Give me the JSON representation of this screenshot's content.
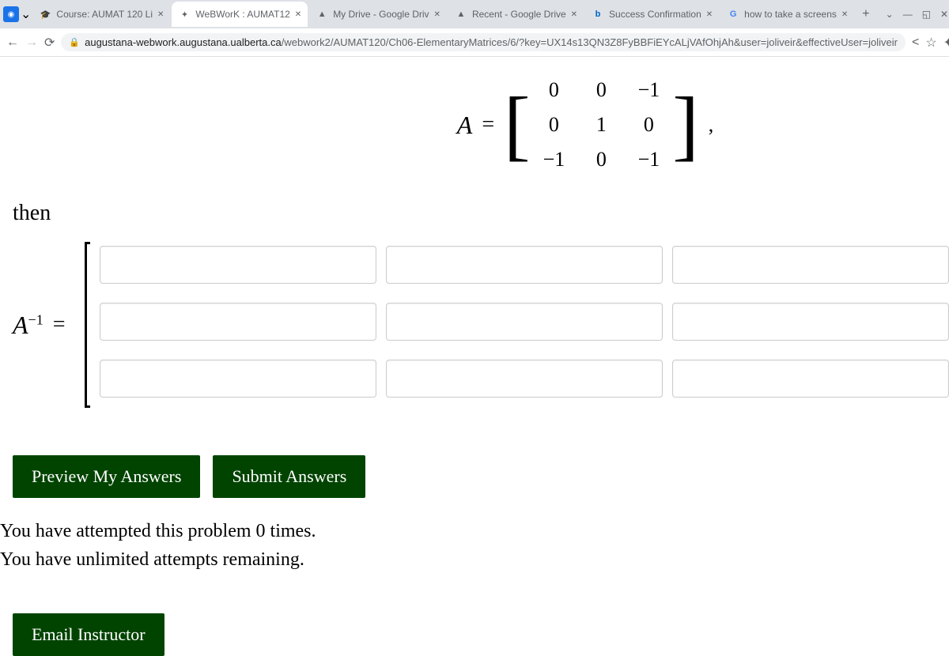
{
  "tabs": [
    {
      "title": "Course: AUMAT 120 Li"
    },
    {
      "title": "WeBWorK : AUMAT12"
    },
    {
      "title": "My Drive - Google Driv"
    },
    {
      "title": "Recent - Google Drive"
    },
    {
      "title": "Success Confirmation"
    },
    {
      "title": "how to take a screens"
    }
  ],
  "url": {
    "host": "augustana-webwork.augustana.ualberta.ca",
    "path": "/webwork2/AUMAT120/Ch06-ElementaryMatrices/6/?key=UX14s13QN3Z8FyBBFiEYcALjVAfOhjAh&user=joliveir&effectiveUser=joliveir"
  },
  "matrix": {
    "label": "A",
    "values": [
      "0",
      "0",
      "−1",
      "0",
      "1",
      "0",
      "−1",
      "0",
      "−1"
    ]
  },
  "then": "then",
  "ainv_label": "A",
  "ainv_exp": "−1",
  "buttons": {
    "preview": "Preview My Answers",
    "submit": "Submit Answers",
    "email": "Email Instructor"
  },
  "status": {
    "attempts": "You have attempted this problem 0 times.",
    "remaining": "You have unlimited attempts remaining."
  }
}
